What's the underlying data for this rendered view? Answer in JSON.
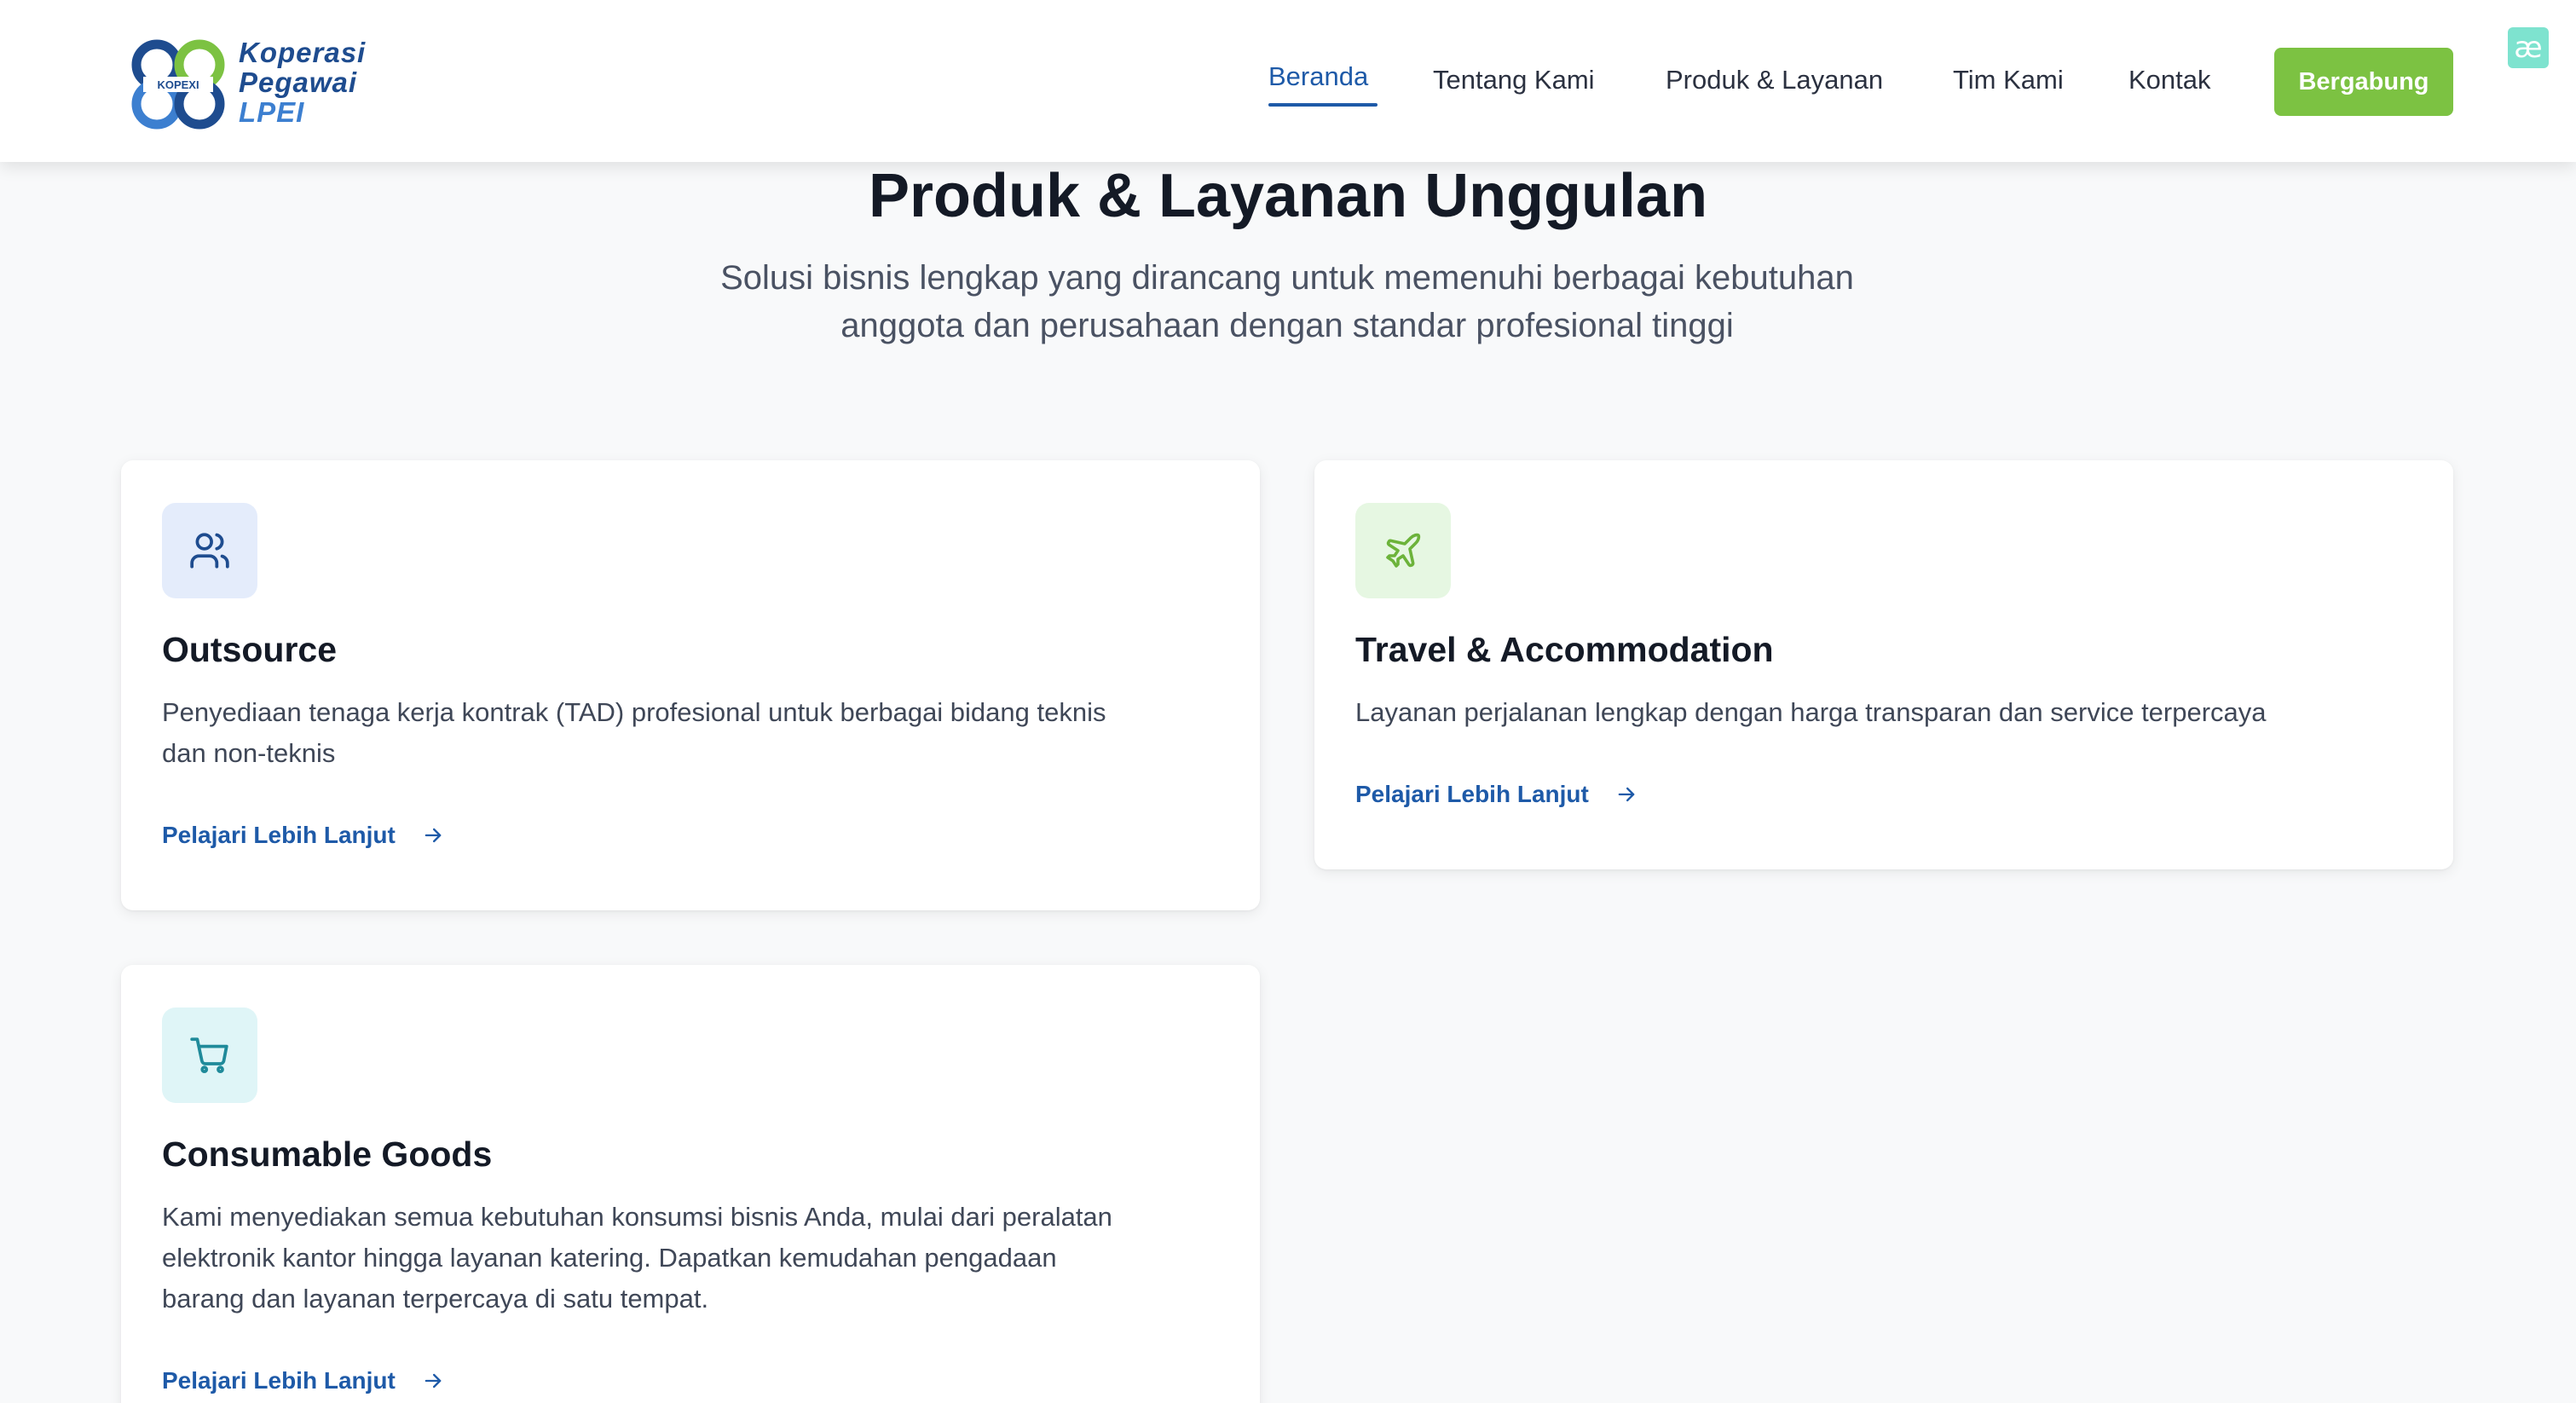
{
  "brand": {
    "badge": "KOPEXI",
    "line1": "Koperasi",
    "line2": "Pegawai",
    "line3": "LPEI"
  },
  "nav": {
    "items": [
      {
        "label": "Beranda",
        "active": true
      },
      {
        "label": "Tentang Kami"
      },
      {
        "label": "Produk & Layanan"
      },
      {
        "label": "Tim Kami"
      },
      {
        "label": "Kontak"
      }
    ],
    "join_label": "Bergabung",
    "ext_badge": "æ"
  },
  "hero": {
    "title": "Produk & Layanan Unggulan",
    "subtitle_line1": "Solusi bisnis lengkap yang dirancang untuk memenuhi berbagai kebutuhan",
    "subtitle_line2": "anggota dan perusahaan dengan standar profesional tinggi"
  },
  "cards": [
    {
      "icon": "users-icon",
      "title": "Outsource",
      "desc_line1": "Penyediaan tenaga kerja kontrak (TAD) profesional untuk berbagai bidang teknis",
      "desc_line2": "dan non-teknis",
      "link": "Pelajari Lebih Lanjut"
    },
    {
      "icon": "plane-icon",
      "title": "Travel & Accommodation",
      "desc_line1": "Layanan perjalanan lengkap dengan harga transparan dan service terpercaya",
      "link": "Pelajari Lebih Lanjut"
    },
    {
      "icon": "cart-icon",
      "title": "Consumable Goods",
      "desc_line1": "Kami menyediakan semua kebutuhan konsumsi bisnis Anda, mulai dari peralatan",
      "desc_line2": "elektronik kantor hingga layanan katering. Dapatkan kemudahan pengadaan",
      "desc_line3": "barang dan layanan terpercaya di satu tempat.",
      "link": "Pelajari Lebih Lanjut"
    }
  ],
  "colors": {
    "primary": "#1e5aa8",
    "accent_green": "#7cc242",
    "background": "#f8f9fa",
    "icon_bg_blue": "#e4ecfb",
    "icon_bg_green": "#e6f7e2",
    "icon_bg_cyan": "#dff5f7"
  }
}
